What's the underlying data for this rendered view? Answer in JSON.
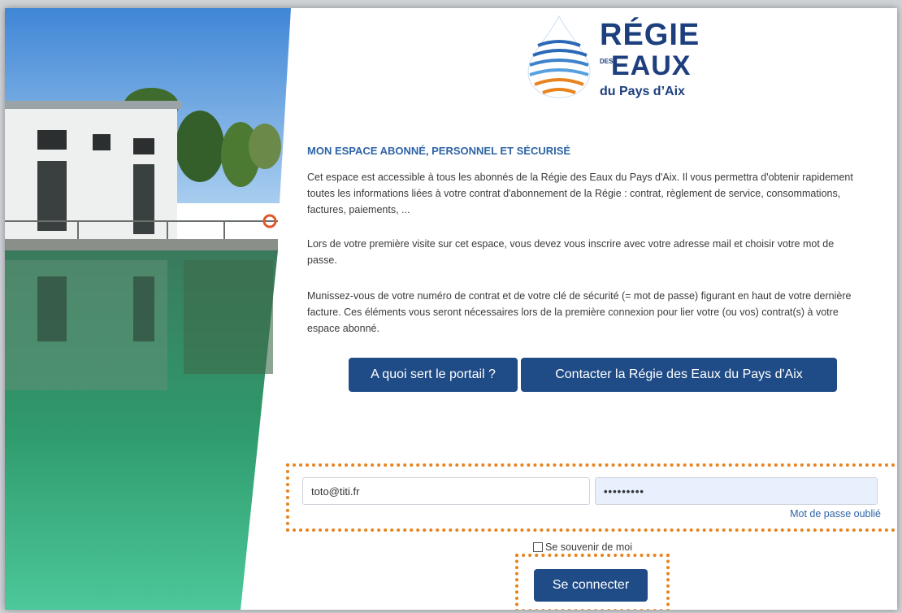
{
  "brand": {
    "line1": "RÉGIE",
    "des": "DES",
    "line2": "EAUX",
    "line3": "du Pays d’Aix"
  },
  "intro": {
    "title": "MON ESPACE ABONNÉ, PERSONNEL ET SÉCURISÉ",
    "paragraphs": [
      "Cet espace est accessible à tous les abonnés de la Régie des Eaux du Pays d'Aix. Il vous permettra d'obtenir rapidement toutes les informations liées à votre contrat d'abonnement de la Régie : contrat, règlement de service, consommations, factures, paiements, ...",
      "Lors de votre première visite sur cet espace, vous devez vous inscrire avec votre adresse mail et choisir votre mot de passe.",
      "Munissez-vous de votre numéro de contrat et de votre clé de sécurité (= mot de passe) figurant en haut de votre dernière facture. Ces éléments vous seront nécessaires lors de la première connexion pour lier votre (ou vos) contrat(s) à votre espace abonné."
    ]
  },
  "actions": {
    "portal_label": "A quoi sert le portail ?",
    "contact_label": "Contacter la Régie des Eaux du Pays d'Aix"
  },
  "login": {
    "email_value": "toto@titi.fr",
    "password_value": "•••••••••",
    "forgot_label": "Mot de passe oublié",
    "remember_label": "Se souvenir de moi",
    "connect_label": "Se connecter"
  },
  "colors": {
    "brand_blue": "#1d3f7e",
    "button_blue": "#1f4b87",
    "highlight_orange": "#e8831e"
  }
}
